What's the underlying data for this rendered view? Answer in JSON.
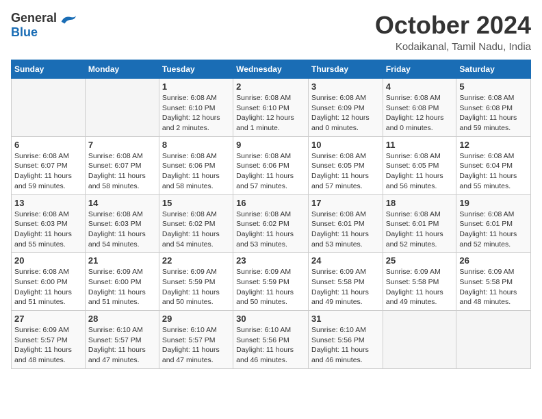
{
  "header": {
    "logo_general": "General",
    "logo_blue": "Blue",
    "month_title": "October 2024",
    "location": "Kodaikanal, Tamil Nadu, India"
  },
  "weekdays": [
    "Sunday",
    "Monday",
    "Tuesday",
    "Wednesday",
    "Thursday",
    "Friday",
    "Saturday"
  ],
  "weeks": [
    [
      {
        "day": "",
        "sunrise": "",
        "sunset": "",
        "daylight": ""
      },
      {
        "day": "",
        "sunrise": "",
        "sunset": "",
        "daylight": ""
      },
      {
        "day": "1",
        "sunrise": "Sunrise: 6:08 AM",
        "sunset": "Sunset: 6:10 PM",
        "daylight": "Daylight: 12 hours and 2 minutes."
      },
      {
        "day": "2",
        "sunrise": "Sunrise: 6:08 AM",
        "sunset": "Sunset: 6:10 PM",
        "daylight": "Daylight: 12 hours and 1 minute."
      },
      {
        "day": "3",
        "sunrise": "Sunrise: 6:08 AM",
        "sunset": "Sunset: 6:09 PM",
        "daylight": "Daylight: 12 hours and 0 minutes."
      },
      {
        "day": "4",
        "sunrise": "Sunrise: 6:08 AM",
        "sunset": "Sunset: 6:08 PM",
        "daylight": "Daylight: 12 hours and 0 minutes."
      },
      {
        "day": "5",
        "sunrise": "Sunrise: 6:08 AM",
        "sunset": "Sunset: 6:08 PM",
        "daylight": "Daylight: 11 hours and 59 minutes."
      }
    ],
    [
      {
        "day": "6",
        "sunrise": "Sunrise: 6:08 AM",
        "sunset": "Sunset: 6:07 PM",
        "daylight": "Daylight: 11 hours and 59 minutes."
      },
      {
        "day": "7",
        "sunrise": "Sunrise: 6:08 AM",
        "sunset": "Sunset: 6:07 PM",
        "daylight": "Daylight: 11 hours and 58 minutes."
      },
      {
        "day": "8",
        "sunrise": "Sunrise: 6:08 AM",
        "sunset": "Sunset: 6:06 PM",
        "daylight": "Daylight: 11 hours and 58 minutes."
      },
      {
        "day": "9",
        "sunrise": "Sunrise: 6:08 AM",
        "sunset": "Sunset: 6:06 PM",
        "daylight": "Daylight: 11 hours and 57 minutes."
      },
      {
        "day": "10",
        "sunrise": "Sunrise: 6:08 AM",
        "sunset": "Sunset: 6:05 PM",
        "daylight": "Daylight: 11 hours and 57 minutes."
      },
      {
        "day": "11",
        "sunrise": "Sunrise: 6:08 AM",
        "sunset": "Sunset: 6:05 PM",
        "daylight": "Daylight: 11 hours and 56 minutes."
      },
      {
        "day": "12",
        "sunrise": "Sunrise: 6:08 AM",
        "sunset": "Sunset: 6:04 PM",
        "daylight": "Daylight: 11 hours and 55 minutes."
      }
    ],
    [
      {
        "day": "13",
        "sunrise": "Sunrise: 6:08 AM",
        "sunset": "Sunset: 6:03 PM",
        "daylight": "Daylight: 11 hours and 55 minutes."
      },
      {
        "day": "14",
        "sunrise": "Sunrise: 6:08 AM",
        "sunset": "Sunset: 6:03 PM",
        "daylight": "Daylight: 11 hours and 54 minutes."
      },
      {
        "day": "15",
        "sunrise": "Sunrise: 6:08 AM",
        "sunset": "Sunset: 6:02 PM",
        "daylight": "Daylight: 11 hours and 54 minutes."
      },
      {
        "day": "16",
        "sunrise": "Sunrise: 6:08 AM",
        "sunset": "Sunset: 6:02 PM",
        "daylight": "Daylight: 11 hours and 53 minutes."
      },
      {
        "day": "17",
        "sunrise": "Sunrise: 6:08 AM",
        "sunset": "Sunset: 6:01 PM",
        "daylight": "Daylight: 11 hours and 53 minutes."
      },
      {
        "day": "18",
        "sunrise": "Sunrise: 6:08 AM",
        "sunset": "Sunset: 6:01 PM",
        "daylight": "Daylight: 11 hours and 52 minutes."
      },
      {
        "day": "19",
        "sunrise": "Sunrise: 6:08 AM",
        "sunset": "Sunset: 6:01 PM",
        "daylight": "Daylight: 11 hours and 52 minutes."
      }
    ],
    [
      {
        "day": "20",
        "sunrise": "Sunrise: 6:08 AM",
        "sunset": "Sunset: 6:00 PM",
        "daylight": "Daylight: 11 hours and 51 minutes."
      },
      {
        "day": "21",
        "sunrise": "Sunrise: 6:09 AM",
        "sunset": "Sunset: 6:00 PM",
        "daylight": "Daylight: 11 hours and 51 minutes."
      },
      {
        "day": "22",
        "sunrise": "Sunrise: 6:09 AM",
        "sunset": "Sunset: 5:59 PM",
        "daylight": "Daylight: 11 hours and 50 minutes."
      },
      {
        "day": "23",
        "sunrise": "Sunrise: 6:09 AM",
        "sunset": "Sunset: 5:59 PM",
        "daylight": "Daylight: 11 hours and 50 minutes."
      },
      {
        "day": "24",
        "sunrise": "Sunrise: 6:09 AM",
        "sunset": "Sunset: 5:58 PM",
        "daylight": "Daylight: 11 hours and 49 minutes."
      },
      {
        "day": "25",
        "sunrise": "Sunrise: 6:09 AM",
        "sunset": "Sunset: 5:58 PM",
        "daylight": "Daylight: 11 hours and 49 minutes."
      },
      {
        "day": "26",
        "sunrise": "Sunrise: 6:09 AM",
        "sunset": "Sunset: 5:58 PM",
        "daylight": "Daylight: 11 hours and 48 minutes."
      }
    ],
    [
      {
        "day": "27",
        "sunrise": "Sunrise: 6:09 AM",
        "sunset": "Sunset: 5:57 PM",
        "daylight": "Daylight: 11 hours and 48 minutes."
      },
      {
        "day": "28",
        "sunrise": "Sunrise: 6:10 AM",
        "sunset": "Sunset: 5:57 PM",
        "daylight": "Daylight: 11 hours and 47 minutes."
      },
      {
        "day": "29",
        "sunrise": "Sunrise: 6:10 AM",
        "sunset": "Sunset: 5:57 PM",
        "daylight": "Daylight: 11 hours and 47 minutes."
      },
      {
        "day": "30",
        "sunrise": "Sunrise: 6:10 AM",
        "sunset": "Sunset: 5:56 PM",
        "daylight": "Daylight: 11 hours and 46 minutes."
      },
      {
        "day": "31",
        "sunrise": "Sunrise: 6:10 AM",
        "sunset": "Sunset: 5:56 PM",
        "daylight": "Daylight: 11 hours and 46 minutes."
      },
      {
        "day": "",
        "sunrise": "",
        "sunset": "",
        "daylight": ""
      },
      {
        "day": "",
        "sunrise": "",
        "sunset": "",
        "daylight": ""
      }
    ]
  ]
}
